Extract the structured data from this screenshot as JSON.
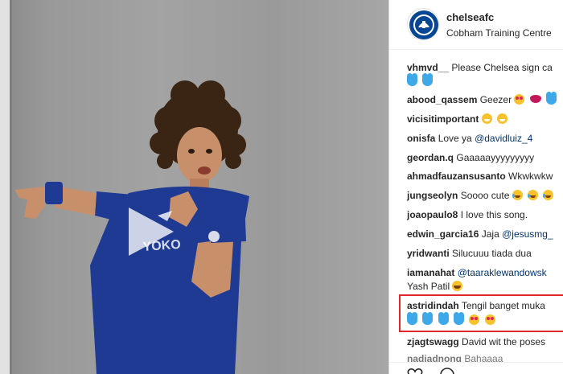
{
  "post": {
    "username": "chelseafc",
    "location": "Cobham Training Centre",
    "video": {
      "play_icon": "play-icon",
      "avatar_icon": "chelsea-crest-icon"
    }
  },
  "comments": [
    {
      "user": "vhmvd__",
      "text": "Please Chelsea sign ca"
    },
    {
      "user": "",
      "text": "",
      "emojis": [
        "heart",
        "heart"
      ]
    },
    {
      "user": "abood_qassem",
      "text": "Geezer",
      "emojis": [
        "hearteyes",
        "lips",
        "heart"
      ]
    },
    {
      "user": "vicisitimportant",
      "text": "",
      "emojis": [
        "grin",
        "grin"
      ]
    },
    {
      "user": "onisfa",
      "text": "Love ya",
      "mention": "@davidluiz_4"
    },
    {
      "user": "geordan.q",
      "text": "Gaaaaayyyyyyyyy"
    },
    {
      "user": "ahmadfauzansusanto",
      "text": "Wkwkwkw"
    },
    {
      "user": "jungseolyn",
      "text": "Soooo cute",
      "emojis": [
        "tears",
        "tears",
        "tears"
      ]
    },
    {
      "user": "joaopaulo8",
      "text": "I love this song."
    },
    {
      "user": "edwin_garcia16",
      "text": "Jaja",
      "mention": "@jesusmg_"
    },
    {
      "user": "yridwanti",
      "text": "Silucuuu tiada dua"
    },
    {
      "user": "iamanahat",
      "text": "",
      "mention": "@taaraklewandowsk"
    },
    {
      "user": "",
      "text": "Yash Patil",
      "emojis": [
        "laugh"
      ]
    },
    {
      "user": "astridindah",
      "text": "Tengil banget muka"
    },
    {
      "user": "",
      "text": "",
      "emojis": [
        "heart",
        "heart",
        "heart",
        "heart",
        "hearteyes",
        "hearteyes"
      ]
    },
    {
      "user": "zjagtswagg",
      "text": "David wit the poses"
    },
    {
      "user": "nadiadnong",
      "text": "Bahaaaa"
    }
  ],
  "colors": {
    "highlight": "#e0262b",
    "jersey": "#1f3a93",
    "link": "#003569",
    "heart": "#3ea8e8"
  }
}
